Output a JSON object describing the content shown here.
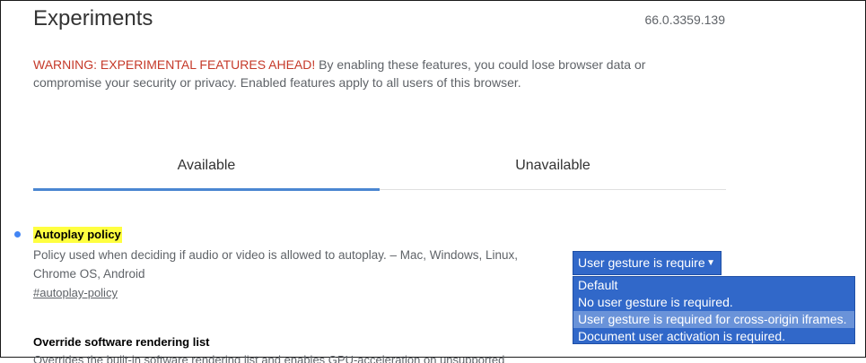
{
  "header": {
    "title": "Experiments",
    "version": "66.0.3359.139"
  },
  "warning": {
    "label": "WARNING: EXPERIMENTAL FEATURES AHEAD!",
    "text": " By enabling these features, you could lose browser data or compromise your security or privacy. Enabled features apply to all users of this browser."
  },
  "tabs": [
    {
      "label": "Available",
      "active": true
    },
    {
      "label": "Unavailable",
      "active": false
    }
  ],
  "experiments": [
    {
      "name": "Autoplay policy",
      "description": "Policy used when deciding if audio or video is allowed to autoplay. – Mac, Windows, Linux, Chrome OS, Android",
      "link": "#autoplay-policy",
      "select": {
        "selected": "User gesture is required for cross-origin iframes.",
        "options": [
          "Default",
          "No user gesture is required.",
          "User gesture is required for cross-origin iframes.",
          "Document user activation is required."
        ],
        "highlighted_index": 2
      }
    },
    {
      "name": "Override software rendering list",
      "description": "Overrides the built-in software rendering list and enables GPU-acceleration on unsupported system configurations."
    }
  ],
  "colors": {
    "warning": "#c53929",
    "accent": "#4a86d1",
    "highlight": "#ffff40",
    "select_bg": "#3168c9",
    "option_highlight": "#6a93d9"
  }
}
